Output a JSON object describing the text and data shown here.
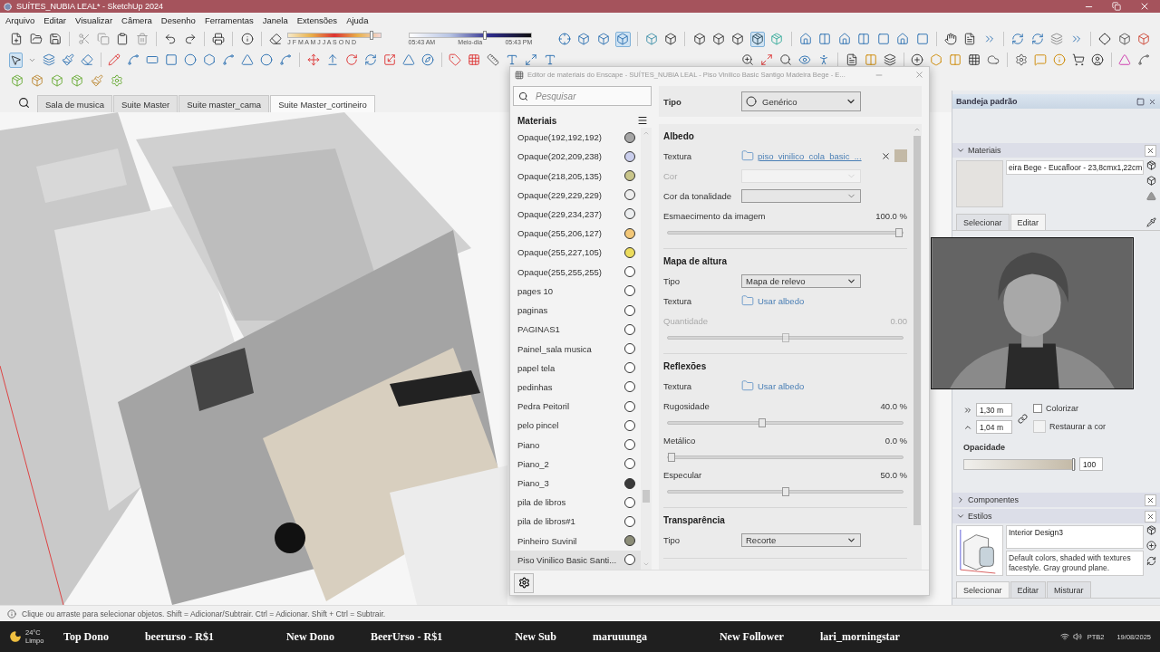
{
  "window": {
    "title": "SUÍTES_NUBIA LEAL* - SketchUp 2024"
  },
  "menu": [
    "Arquivo",
    "Editar",
    "Visualizar",
    "Câmera",
    "Desenho",
    "Ferramentas",
    "Janela",
    "Extensões",
    "Ajuda"
  ],
  "shadows": {
    "months": "J F M A M J J A S O N D",
    "date": {
      "level": 0.9
    },
    "times": [
      "05:43 AM",
      "Meio-dia",
      "05:43 PM"
    ],
    "time": {
      "level": 0.62
    }
  },
  "scene_tabs": [
    {
      "label": "Sala de musica",
      "selected": false
    },
    {
      "label": "Suite Master",
      "selected": false
    },
    {
      "label": "Suite master_cama",
      "selected": false
    },
    {
      "label": "Suite Master_cortineiro",
      "selected": true
    }
  ],
  "editor": {
    "title": "Editor de materiais do Enscape - SUÍTES_NUBIA LEAL - Piso Vinilico Basic Santigo Madeira Bege - E...",
    "search_placeholder": "Pesquisar",
    "list_title": "Materiais",
    "materials": [
      {
        "name": "Opaque(192,192,192)",
        "color": "#a6a6a6",
        "selected": false
      },
      {
        "name": "Opaque(202,209,238)",
        "color": "#caceec",
        "selected": false
      },
      {
        "name": "Opaque(218,205,135)",
        "color": "#c9c58a",
        "selected": false
      },
      {
        "name": "Opaque(229,229,229)",
        "color": "#eeeeee",
        "selected": false
      },
      {
        "name": "Opaque(229,234,237)",
        "color": "#eceef0",
        "selected": false
      },
      {
        "name": "Opaque(255,206,127)",
        "color": "#f2c777",
        "selected": false
      },
      {
        "name": "Opaque(255,227,105)",
        "color": "#ecdc5c",
        "selected": false
      },
      {
        "name": "Opaque(255,255,255)",
        "color": "#ffffff",
        "selected": false
      },
      {
        "name": "pages 10",
        "color": "#ffffff",
        "selected": false
      },
      {
        "name": "paginas",
        "color": "#ffffff",
        "selected": false
      },
      {
        "name": "PAGINAS1",
        "color": "#ffffff",
        "selected": false
      },
      {
        "name": "Painel_sala musica",
        "color": "#ffffff",
        "selected": false
      },
      {
        "name": "papel tela",
        "color": "#ffffff",
        "selected": false
      },
      {
        "name": "pedinhas",
        "color": "#ffffff",
        "selected": false
      },
      {
        "name": "Pedra Peitoril",
        "color": "#ffffff",
        "selected": false
      },
      {
        "name": "pelo pincel",
        "color": "#ffffff",
        "selected": false
      },
      {
        "name": "Piano",
        "color": "#ffffff",
        "selected": false
      },
      {
        "name": "Piano_2",
        "color": "#ffffff",
        "selected": false
      },
      {
        "name": "Piano_3",
        "color": "#3a3a3a",
        "selected": false
      },
      {
        "name": "pila de libros",
        "color": "#ffffff",
        "selected": false
      },
      {
        "name": "pila de libros#1",
        "color": "#ffffff",
        "selected": false
      },
      {
        "name": "Pinheiro Suvinil",
        "color": "#8c8d78",
        "selected": false
      },
      {
        "name": "Piso Vinilico Basic Santi...",
        "color": "#ffffff",
        "selected": true
      }
    ],
    "type_label": "Tipo",
    "type_value": "Genérico",
    "sections": [
      {
        "title": "Albedo",
        "rows": [
          {
            "kind": "texture",
            "label": "Textura",
            "link": "piso_vinilico_cola_basic_...",
            "removable": true,
            "color": "#c3b9a6"
          },
          {
            "kind": "dropdown",
            "label": "Cor",
            "disabled": true
          },
          {
            "kind": "dropdown",
            "label": "Cor da tonalidade",
            "disabled": false
          },
          {
            "kind": "slider",
            "label": "Esmaecimento da imagem",
            "reading": "100.0 %",
            "level": 1,
            "disabled": false
          }
        ]
      },
      {
        "title": "Mapa de altura",
        "rows": [
          {
            "kind": "dropdown",
            "label": "Tipo",
            "value": "Mapa de relevo",
            "disabled": false
          },
          {
            "kind": "texture",
            "label": "Textura",
            "link": "Usar albedo",
            "removable": false
          },
          {
            "kind": "slider",
            "label": "Quantidade",
            "reading": "0.00",
            "level": 0.5,
            "disabled": true
          }
        ]
      },
      {
        "title": "Reflexões",
        "rows": [
          {
            "kind": "texture",
            "label": "Textura",
            "link": "Usar albedo",
            "removable": false
          },
          {
            "kind": "slider",
            "label": "Rugosidade",
            "reading": "40.0 %",
            "level": 0.4,
            "disabled": false
          },
          {
            "kind": "slider",
            "label": "Metálico",
            "reading": "0.0 %",
            "level": 0,
            "disabled": false
          },
          {
            "kind": "slider",
            "label": "Especular",
            "reading": "50.0 %",
            "level": 0.5,
            "disabled": false
          }
        ]
      },
      {
        "title": "Transparência",
        "rows": [
          {
            "kind": "dropdown",
            "label": "Tipo",
            "value": "Recorte",
            "disabled": false
          }
        ]
      }
    ]
  },
  "tray": {
    "title": "Bandeja padrão",
    "materials_panel": {
      "title": "Materiais",
      "expanded": true,
      "name": "eira Bege - Eucafloor - 23,8cmx1,22cm",
      "tabs": [
        {
          "label": "Selecionar",
          "selected": false
        },
        {
          "label": "Editar",
          "selected": true
        }
      ],
      "width": "1,30 m",
      "height": "1,04 m",
      "colorize": {
        "label": "Colorizar",
        "checked": false
      },
      "reset_label": "Restaurar a cor",
      "opacity_label": "Opacidade",
      "opacity": {
        "level": 1,
        "value": "100"
      }
    },
    "components_panel": {
      "title": "Componentes",
      "expanded": false
    },
    "styles_panel": {
      "title": "Estilos",
      "expanded": true,
      "name": "Interior Design3",
      "description": "Default colors, shaded with textures facestyle. Gray ground plane.",
      "tabs": [
        {
          "label": "Selecionar",
          "selected": true
        },
        {
          "label": "Editar",
          "selected": false
        },
        {
          "label": "Misturar",
          "selected": false
        }
      ]
    }
  },
  "status_bar": "Clique ou arraste para selecionar objetos. Shift = Adicionar/Subtrair. Ctrl = Adicionar. Shift + Ctrl = Subtrair.",
  "taskbar": {
    "weather": {
      "temp": "24°C",
      "condition": "Limpo"
    },
    "ticker": [
      {
        "kind": "label",
        "text": "Top Dono"
      },
      {
        "kind": "name",
        "text": "beerurso - R$1"
      },
      {
        "kind": "label",
        "text": "New Dono"
      },
      {
        "kind": "name",
        "text": "BeerUrso - R$1"
      },
      {
        "kind": "label",
        "text": "New Sub"
      },
      {
        "kind": "name",
        "text": "maruuunga"
      },
      {
        "kind": "label",
        "text": "New Follower"
      },
      {
        "kind": "name",
        "text": "lari_morningstar"
      }
    ],
    "language": "PTB2",
    "date": "19/08/2025"
  }
}
